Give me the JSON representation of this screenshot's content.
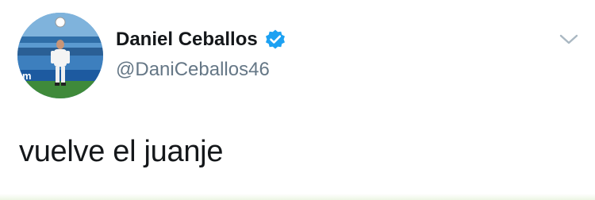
{
  "tweet": {
    "author": {
      "display_name": "Daniel Ceballos",
      "handle": "@DaniCeballos46",
      "verified": true,
      "avatar_icon": "profile-photo-stadium"
    },
    "text": "vuelve el juanje",
    "menu_icon": "chevron-down-icon"
  },
  "colors": {
    "text_primary": "#14171a",
    "text_secondary": "#657786",
    "verified_badge": "#1da1f2",
    "caret": "#aab8c2",
    "background": "#ffffff"
  }
}
